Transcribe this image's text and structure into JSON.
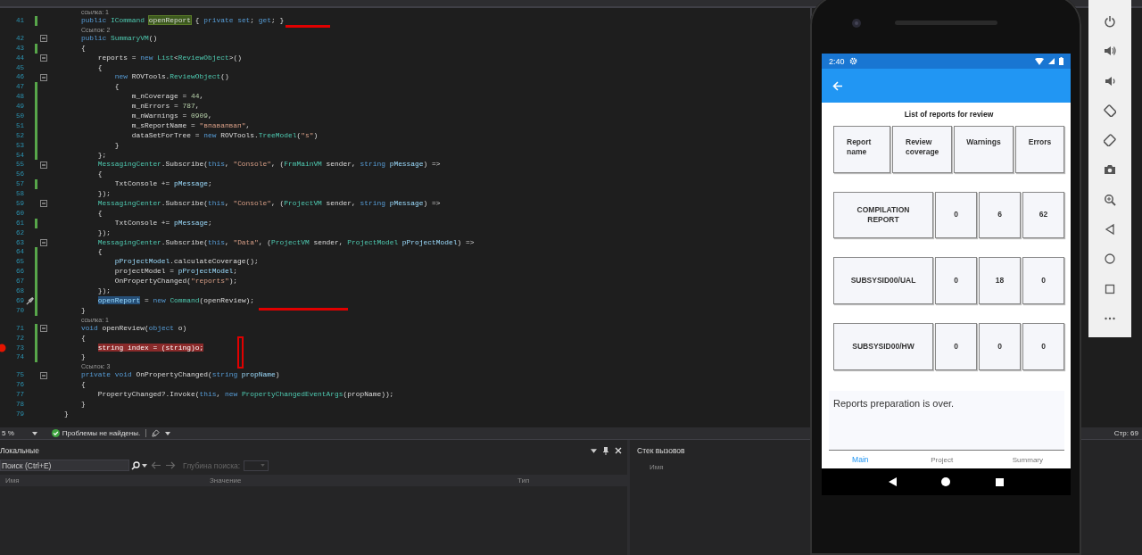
{
  "editor": {
    "lines": [
      {
        "number": "41",
        "lens": "ссылка: 1",
        "changed": true,
        "foldable": false,
        "breakpoint": false,
        "quick_actions": false,
        "tokens": [
          {
            "kind": "keyword",
            "text": "        public "
          },
          {
            "kind": "type",
            "text": "ICommand "
          },
          {
            "kind": "definition",
            "text": "openReport"
          },
          {
            "kind": "plain",
            "text": " { "
          },
          {
            "kind": "keyword",
            "text": "private set"
          },
          {
            "kind": "plain",
            "text": "; "
          },
          {
            "kind": "keyword",
            "text": "get"
          },
          {
            "kind": "plain",
            "text": "; }"
          }
        ]
      },
      {
        "number": "42",
        "lens": "Ссылок: 2",
        "changed": false,
        "foldable": true,
        "breakpoint": false,
        "quick_actions": false,
        "tokens": [
          {
            "kind": "keyword",
            "text": "        public "
          },
          {
            "kind": "type",
            "text": "SummaryVM"
          },
          {
            "kind": "plain",
            "text": "()"
          }
        ]
      },
      {
        "number": "43",
        "changed": true,
        "foldable": false,
        "breakpoint": false,
        "quick_actions": false,
        "tokens": [
          {
            "kind": "plain",
            "text": "        {"
          }
        ]
      },
      {
        "number": "44",
        "changed": false,
        "foldable": true,
        "breakpoint": false,
        "quick_actions": false,
        "tokens": [
          {
            "kind": "plain",
            "text": "            reports = "
          },
          {
            "kind": "keyword",
            "text": "new "
          },
          {
            "kind": "type",
            "text": "List"
          },
          {
            "kind": "plain",
            "text": "<"
          },
          {
            "kind": "type",
            "text": "ReviewObject"
          },
          {
            "kind": "plain",
            "text": ">()"
          }
        ]
      },
      {
        "number": "45",
        "changed": false,
        "foldable": false,
        "breakpoint": false,
        "quick_actions": false,
        "tokens": [
          {
            "kind": "plain",
            "text": "            {"
          }
        ]
      },
      {
        "number": "46",
        "changed": false,
        "foldable": true,
        "breakpoint": false,
        "quick_actions": false,
        "tokens": [
          {
            "kind": "keyword",
            "text": "                new"
          },
          {
            "kind": "plain",
            "text": " ROVTools."
          },
          {
            "kind": "type",
            "text": "ReviewObject"
          },
          {
            "kind": "plain",
            "text": "()"
          }
        ]
      },
      {
        "number": "47",
        "changed": true,
        "foldable": false,
        "breakpoint": false,
        "quick_actions": false,
        "tokens": [
          {
            "kind": "plain",
            "text": "                {"
          }
        ]
      },
      {
        "number": "48",
        "changed": true,
        "foldable": false,
        "breakpoint": false,
        "quick_actions": false,
        "tokens": [
          {
            "kind": "plain",
            "text": "                    m_nCoverage = "
          },
          {
            "kind": "number",
            "text": "44"
          },
          {
            "kind": "plain",
            "text": ","
          }
        ]
      },
      {
        "number": "49",
        "changed": true,
        "foldable": false,
        "breakpoint": false,
        "quick_actions": false,
        "tokens": [
          {
            "kind": "plain",
            "text": "                    m_nErrors = "
          },
          {
            "kind": "number",
            "text": "787"
          },
          {
            "kind": "plain",
            "text": ","
          }
        ]
      },
      {
        "number": "50",
        "changed": true,
        "foldable": false,
        "breakpoint": false,
        "quick_actions": false,
        "tokens": [
          {
            "kind": "plain",
            "text": "                    m_nWarnings = "
          },
          {
            "kind": "number",
            "text": "0909"
          },
          {
            "kind": "plain",
            "text": ","
          }
        ]
      },
      {
        "number": "51",
        "changed": true,
        "foldable": false,
        "breakpoint": false,
        "quick_actions": false,
        "tokens": [
          {
            "kind": "plain",
            "text": "                    m_sReportName = "
          },
          {
            "kind": "string",
            "text": "\"впавапвап\""
          },
          {
            "kind": "plain",
            "text": ","
          }
        ]
      },
      {
        "number": "52",
        "changed": true,
        "foldable": false,
        "breakpoint": false,
        "quick_actions": false,
        "tokens": [
          {
            "kind": "plain",
            "text": "                    dataSetForTree = "
          },
          {
            "kind": "keyword",
            "text": "new"
          },
          {
            "kind": "plain",
            "text": " ROVTools."
          },
          {
            "kind": "type",
            "text": "TreeModel"
          },
          {
            "kind": "plain",
            "text": "("
          },
          {
            "kind": "string",
            "text": "\"s\""
          },
          {
            "kind": "plain",
            "text": ")"
          }
        ]
      },
      {
        "number": "53",
        "changed": true,
        "foldable": false,
        "breakpoint": false,
        "quick_actions": false,
        "tokens": [
          {
            "kind": "plain",
            "text": "                }"
          }
        ]
      },
      {
        "number": "54",
        "changed": true,
        "foldable": false,
        "breakpoint": false,
        "quick_actions": false,
        "tokens": [
          {
            "kind": "plain",
            "text": "            };"
          }
        ]
      },
      {
        "number": "55",
        "changed": false,
        "foldable": true,
        "breakpoint": false,
        "quick_actions": false,
        "tokens": [
          {
            "kind": "type",
            "text": "            MessagingCenter"
          },
          {
            "kind": "plain",
            "text": ".Subscribe("
          },
          {
            "kind": "keyword",
            "text": "this"
          },
          {
            "kind": "plain",
            "text": ", "
          },
          {
            "kind": "string",
            "text": "\"Console\""
          },
          {
            "kind": "plain",
            "text": ", ("
          },
          {
            "kind": "type",
            "text": "FrmMainVM"
          },
          {
            "kind": "plain",
            "text": " sender, "
          },
          {
            "kind": "keyword",
            "text": "string "
          },
          {
            "kind": "param",
            "text": "pMessage"
          },
          {
            "kind": "plain",
            "text": ") =>"
          }
        ]
      },
      {
        "number": "56",
        "changed": false,
        "foldable": false,
        "breakpoint": false,
        "quick_actions": false,
        "tokens": [
          {
            "kind": "plain",
            "text": "            {"
          }
        ]
      },
      {
        "number": "57",
        "changed": true,
        "foldable": false,
        "breakpoint": false,
        "quick_actions": false,
        "tokens": [
          {
            "kind": "plain",
            "text": "                TxtConsole += "
          },
          {
            "kind": "param",
            "text": "pMessage"
          },
          {
            "kind": "plain",
            "text": ";"
          }
        ]
      },
      {
        "number": "58",
        "changed": false,
        "foldable": false,
        "breakpoint": false,
        "quick_actions": false,
        "tokens": [
          {
            "kind": "plain",
            "text": "            });"
          }
        ]
      },
      {
        "number": "59",
        "changed": false,
        "foldable": true,
        "breakpoint": false,
        "quick_actions": false,
        "tokens": [
          {
            "kind": "type",
            "text": "            MessagingCenter"
          },
          {
            "kind": "plain",
            "text": ".Subscribe("
          },
          {
            "kind": "keyword",
            "text": "this"
          },
          {
            "kind": "plain",
            "text": ", "
          },
          {
            "kind": "string",
            "text": "\"Console\""
          },
          {
            "kind": "plain",
            "text": ", ("
          },
          {
            "kind": "type",
            "text": "ProjectVM"
          },
          {
            "kind": "plain",
            "text": " sender, "
          },
          {
            "kind": "keyword",
            "text": "string "
          },
          {
            "kind": "param",
            "text": "pMessage"
          },
          {
            "kind": "plain",
            "text": ") =>"
          }
        ]
      },
      {
        "number": "60",
        "changed": false,
        "foldable": false,
        "breakpoint": false,
        "quick_actions": false,
        "tokens": [
          {
            "kind": "plain",
            "text": "            {"
          }
        ]
      },
      {
        "number": "61",
        "changed": true,
        "foldable": false,
        "breakpoint": false,
        "quick_actions": false,
        "tokens": [
          {
            "kind": "plain",
            "text": "                TxtConsole += "
          },
          {
            "kind": "param",
            "text": "pMessage"
          },
          {
            "kind": "plain",
            "text": ";"
          }
        ]
      },
      {
        "number": "62",
        "changed": false,
        "foldable": false,
        "breakpoint": false,
        "quick_actions": false,
        "tokens": [
          {
            "kind": "plain",
            "text": "            });"
          }
        ]
      },
      {
        "number": "63",
        "changed": false,
        "foldable": true,
        "breakpoint": false,
        "quick_actions": false,
        "tokens": [
          {
            "kind": "type",
            "text": "            MessagingCenter"
          },
          {
            "kind": "plain",
            "text": ".Subscribe("
          },
          {
            "kind": "keyword",
            "text": "this"
          },
          {
            "kind": "plain",
            "text": ", "
          },
          {
            "kind": "string",
            "text": "\"Data\""
          },
          {
            "kind": "plain",
            "text": ", ("
          },
          {
            "kind": "type",
            "text": "ProjectVM"
          },
          {
            "kind": "plain",
            "text": " sender, "
          },
          {
            "kind": "type",
            "text": "ProjectModel "
          },
          {
            "kind": "param",
            "text": "pProjectModel"
          },
          {
            "kind": "plain",
            "text": ") =>"
          }
        ]
      },
      {
        "number": "64",
        "changed": true,
        "foldable": false,
        "breakpoint": false,
        "quick_actions": false,
        "tokens": [
          {
            "kind": "plain",
            "text": "            {"
          }
        ]
      },
      {
        "number": "65",
        "changed": true,
        "foldable": false,
        "breakpoint": false,
        "quick_actions": false,
        "tokens": [
          {
            "kind": "param",
            "text": "                pProjectModel"
          },
          {
            "kind": "plain",
            "text": ".calculateCoverage();"
          }
        ]
      },
      {
        "number": "66",
        "changed": true,
        "foldable": false,
        "breakpoint": false,
        "quick_actions": false,
        "tokens": [
          {
            "kind": "plain",
            "text": "                projectModel = "
          },
          {
            "kind": "param",
            "text": "pProjectModel"
          },
          {
            "kind": "plain",
            "text": ";"
          }
        ]
      },
      {
        "number": "67",
        "changed": true,
        "foldable": false,
        "breakpoint": false,
        "quick_actions": false,
        "tokens": [
          {
            "kind": "plain",
            "text": "                OnPropertyChanged("
          },
          {
            "kind": "string",
            "text": "\"reports\""
          },
          {
            "kind": "plain",
            "text": ");"
          }
        ]
      },
      {
        "number": "68",
        "changed": true,
        "foldable": false,
        "breakpoint": false,
        "quick_actions": false,
        "tokens": [
          {
            "kind": "plain",
            "text": "            });"
          }
        ]
      },
      {
        "number": "69",
        "changed": true,
        "foldable": false,
        "breakpoint": false,
        "quick_actions": true,
        "tokens": [
          {
            "kind": "reference",
            "text": "            openReport"
          },
          {
            "kind": "plain",
            "text": " = "
          },
          {
            "kind": "keyword",
            "text": "new "
          },
          {
            "kind": "type",
            "text": "Command"
          },
          {
            "kind": "plain",
            "text": "(openReview);"
          }
        ]
      },
      {
        "number": "70",
        "changed": true,
        "foldable": false,
        "breakpoint": false,
        "quick_actions": false,
        "tokens": [
          {
            "kind": "plain",
            "text": "        }"
          }
        ]
      },
      {
        "number": "71",
        "lens": "ссылка: 1",
        "changed": true,
        "foldable": true,
        "breakpoint": false,
        "quick_actions": false,
        "tokens": [
          {
            "kind": "keyword",
            "text": "        void"
          },
          {
            "kind": "plain",
            "text": " openReview("
          },
          {
            "kind": "keyword",
            "text": "object"
          },
          {
            "kind": "plain",
            "text": " o)"
          }
        ]
      },
      {
        "number": "72",
        "changed": true,
        "foldable": false,
        "breakpoint": false,
        "quick_actions": false,
        "tokens": [
          {
            "kind": "plain",
            "text": "        {"
          }
        ]
      },
      {
        "number": "73",
        "changed": true,
        "foldable": false,
        "breakpoint": true,
        "quick_actions": false,
        "tokens": [
          {
            "kind": "breakpoint-statement",
            "text": "            string index = (string)o;"
          }
        ]
      },
      {
        "number": "74",
        "changed": true,
        "foldable": false,
        "breakpoint": false,
        "quick_actions": false,
        "tokens": [
          {
            "kind": "plain",
            "text": "        }"
          }
        ]
      },
      {
        "number": "75",
        "lens": "Ссылок: 3",
        "changed": false,
        "foldable": true,
        "breakpoint": false,
        "quick_actions": false,
        "tokens": [
          {
            "kind": "keyword",
            "text": "        private void"
          },
          {
            "kind": "plain",
            "text": " OnPropertyChanged("
          },
          {
            "kind": "keyword",
            "text": "string "
          },
          {
            "kind": "param",
            "text": "propName"
          },
          {
            "kind": "plain",
            "text": ")"
          }
        ]
      },
      {
        "number": "76",
        "changed": false,
        "foldable": false,
        "breakpoint": false,
        "quick_actions": false,
        "tokens": [
          {
            "kind": "plain",
            "text": "        {"
          }
        ]
      },
      {
        "number": "77",
        "changed": false,
        "foldable": false,
        "breakpoint": false,
        "quick_actions": false,
        "tokens": [
          {
            "kind": "plain",
            "text": "            PropertyChanged?.Invoke("
          },
          {
            "kind": "keyword",
            "text": "this"
          },
          {
            "kind": "plain",
            "text": ", "
          },
          {
            "kind": "keyword",
            "text": "new "
          },
          {
            "kind": "type",
            "text": "PropertyChangedEventArgs"
          },
          {
            "kind": "plain",
            "text": "(propName));"
          }
        ]
      },
      {
        "number": "78",
        "changed": false,
        "foldable": false,
        "breakpoint": false,
        "quick_actions": false,
        "tokens": [
          {
            "kind": "plain",
            "text": "        }"
          }
        ]
      },
      {
        "number": "79",
        "changed": false,
        "foldable": false,
        "breakpoint": false,
        "quick_actions": false,
        "tokens": [
          {
            "kind": "plain",
            "text": "    }"
          }
        ]
      }
    ]
  },
  "status_bar": {
    "zoom": "5 %",
    "issues": "Проблемы не найдены.",
    "position": "Стр: 69"
  },
  "locals_panel": {
    "title": "Локальные",
    "search": {
      "placeholder": "Поиск (Ctrl+E)"
    },
    "depth_label": "Глубина поиска:",
    "columns": [
      "Имя",
      "Значение",
      "Тип"
    ]
  },
  "call_stack_panel": {
    "title": "Стек вызовов",
    "columns": [
      "Имя"
    ]
  },
  "phone": {
    "time": "2:40",
    "title": "List of reports for review",
    "headers": [
      "Report name",
      "Review coverage",
      "Warnings",
      "Errors"
    ],
    "rows": [
      {
        "name": "COMPILATION REPORT",
        "coverage": "0",
        "warnings": "6",
        "errors": "62"
      },
      {
        "name": "SUBSYSID00/UAL",
        "coverage": "0",
        "warnings": "18",
        "errors": "0"
      },
      {
        "name": "SUBSYSID00/HW",
        "coverage": "0",
        "warnings": "0",
        "errors": "0"
      }
    ],
    "console": "Reports preparation is over.",
    "tabs": [
      {
        "label": "Main",
        "selected": true
      },
      {
        "label": "Project",
        "selected": false
      },
      {
        "label": "Summary",
        "selected": false
      }
    ]
  }
}
